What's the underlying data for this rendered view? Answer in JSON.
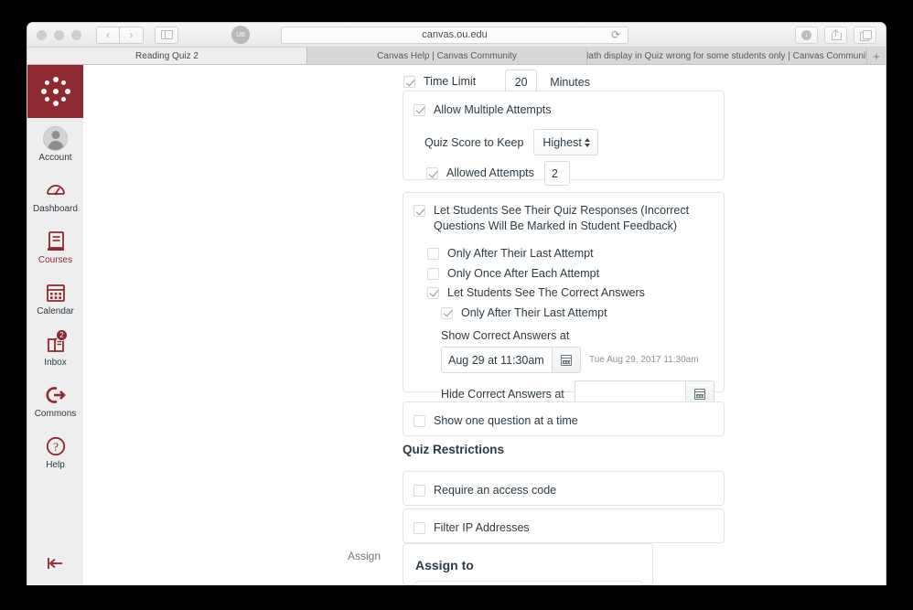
{
  "browser": {
    "url": "canvas.ou.edu",
    "reload_icon": "reload-icon",
    "back_icon": "chevron-left-icon",
    "forward_icon": "chevron-right-icon",
    "sidebar_icon": "sidebar-toggle-icon",
    "extension_icon": "extension-icon",
    "downloads_icon": "downloads-icon",
    "share_icon": "share-icon",
    "tabs_overview_icon": "tabs-overview-icon",
    "new_tab_label": "+",
    "tabs": [
      {
        "title": "Reading Quiz 2",
        "active": true
      },
      {
        "title": "Canvas Help | Canvas Community",
        "active": false
      },
      {
        "title": "Math display in Quiz wrong for some students only | Canvas Community",
        "active": false
      }
    ]
  },
  "global_nav": {
    "logo_name": "canvas-logo",
    "items": [
      {
        "label": "Account",
        "icon": "avatar-icon",
        "badge": ""
      },
      {
        "label": "Dashboard",
        "icon": "dashboard-icon",
        "badge": ""
      },
      {
        "label": "Courses",
        "icon": "courses-icon",
        "badge": ""
      },
      {
        "label": "Calendar",
        "icon": "calendar-icon",
        "badge": ""
      },
      {
        "label": "Inbox",
        "icon": "inbox-icon",
        "badge": "2"
      },
      {
        "label": "Commons",
        "icon": "commons-icon",
        "badge": ""
      },
      {
        "label": "Help",
        "icon": "help-icon",
        "badge": ""
      }
    ],
    "collapse_icon": "collapse-nav-icon"
  },
  "quiz_form": {
    "time_limit": {
      "label": "Time Limit",
      "checked": true,
      "value": "20",
      "unit": "Minutes"
    },
    "multiple_attempts": {
      "label": "Allow Multiple Attempts",
      "checked": true,
      "score_to_keep_label": "Quiz Score to Keep",
      "score_to_keep_value": "Highest",
      "allowed_attempts_label": "Allowed Attempts",
      "allowed_attempts_checked": true,
      "allowed_attempts_value": "2"
    },
    "responses": {
      "label": "Let Students See Their Quiz Responses (Incorrect Questions Will Be Marked in Student Feedback)",
      "checked": true,
      "options": [
        {
          "label": "Only After Their Last Attempt",
          "checked": false
        },
        {
          "label": "Only Once After Each Attempt",
          "checked": false
        },
        {
          "label": "Let Students See The Correct Answers",
          "checked": true
        }
      ],
      "nested_option": {
        "label": "Only After Their Last Attempt",
        "checked": true
      },
      "show_correct_label": "Show Correct Answers at",
      "show_correct_value": "Aug 29 at 11:30am",
      "show_correct_helper": "Tue Aug 29, 2017 11:30am",
      "hide_correct_label": "Hide Correct Answers at",
      "hide_correct_value": "",
      "calendar_icon": "calendar-picker-icon"
    },
    "one_question": {
      "label": "Show one question at a time",
      "checked": false
    },
    "restrictions_heading": "Quiz Restrictions",
    "restrictions": [
      {
        "label": "Require an access code",
        "checked": false
      },
      {
        "label": "Filter IP Addresses",
        "checked": false
      }
    ],
    "assign": {
      "side_label": "Assign",
      "panel_title": "Assign to"
    }
  }
}
